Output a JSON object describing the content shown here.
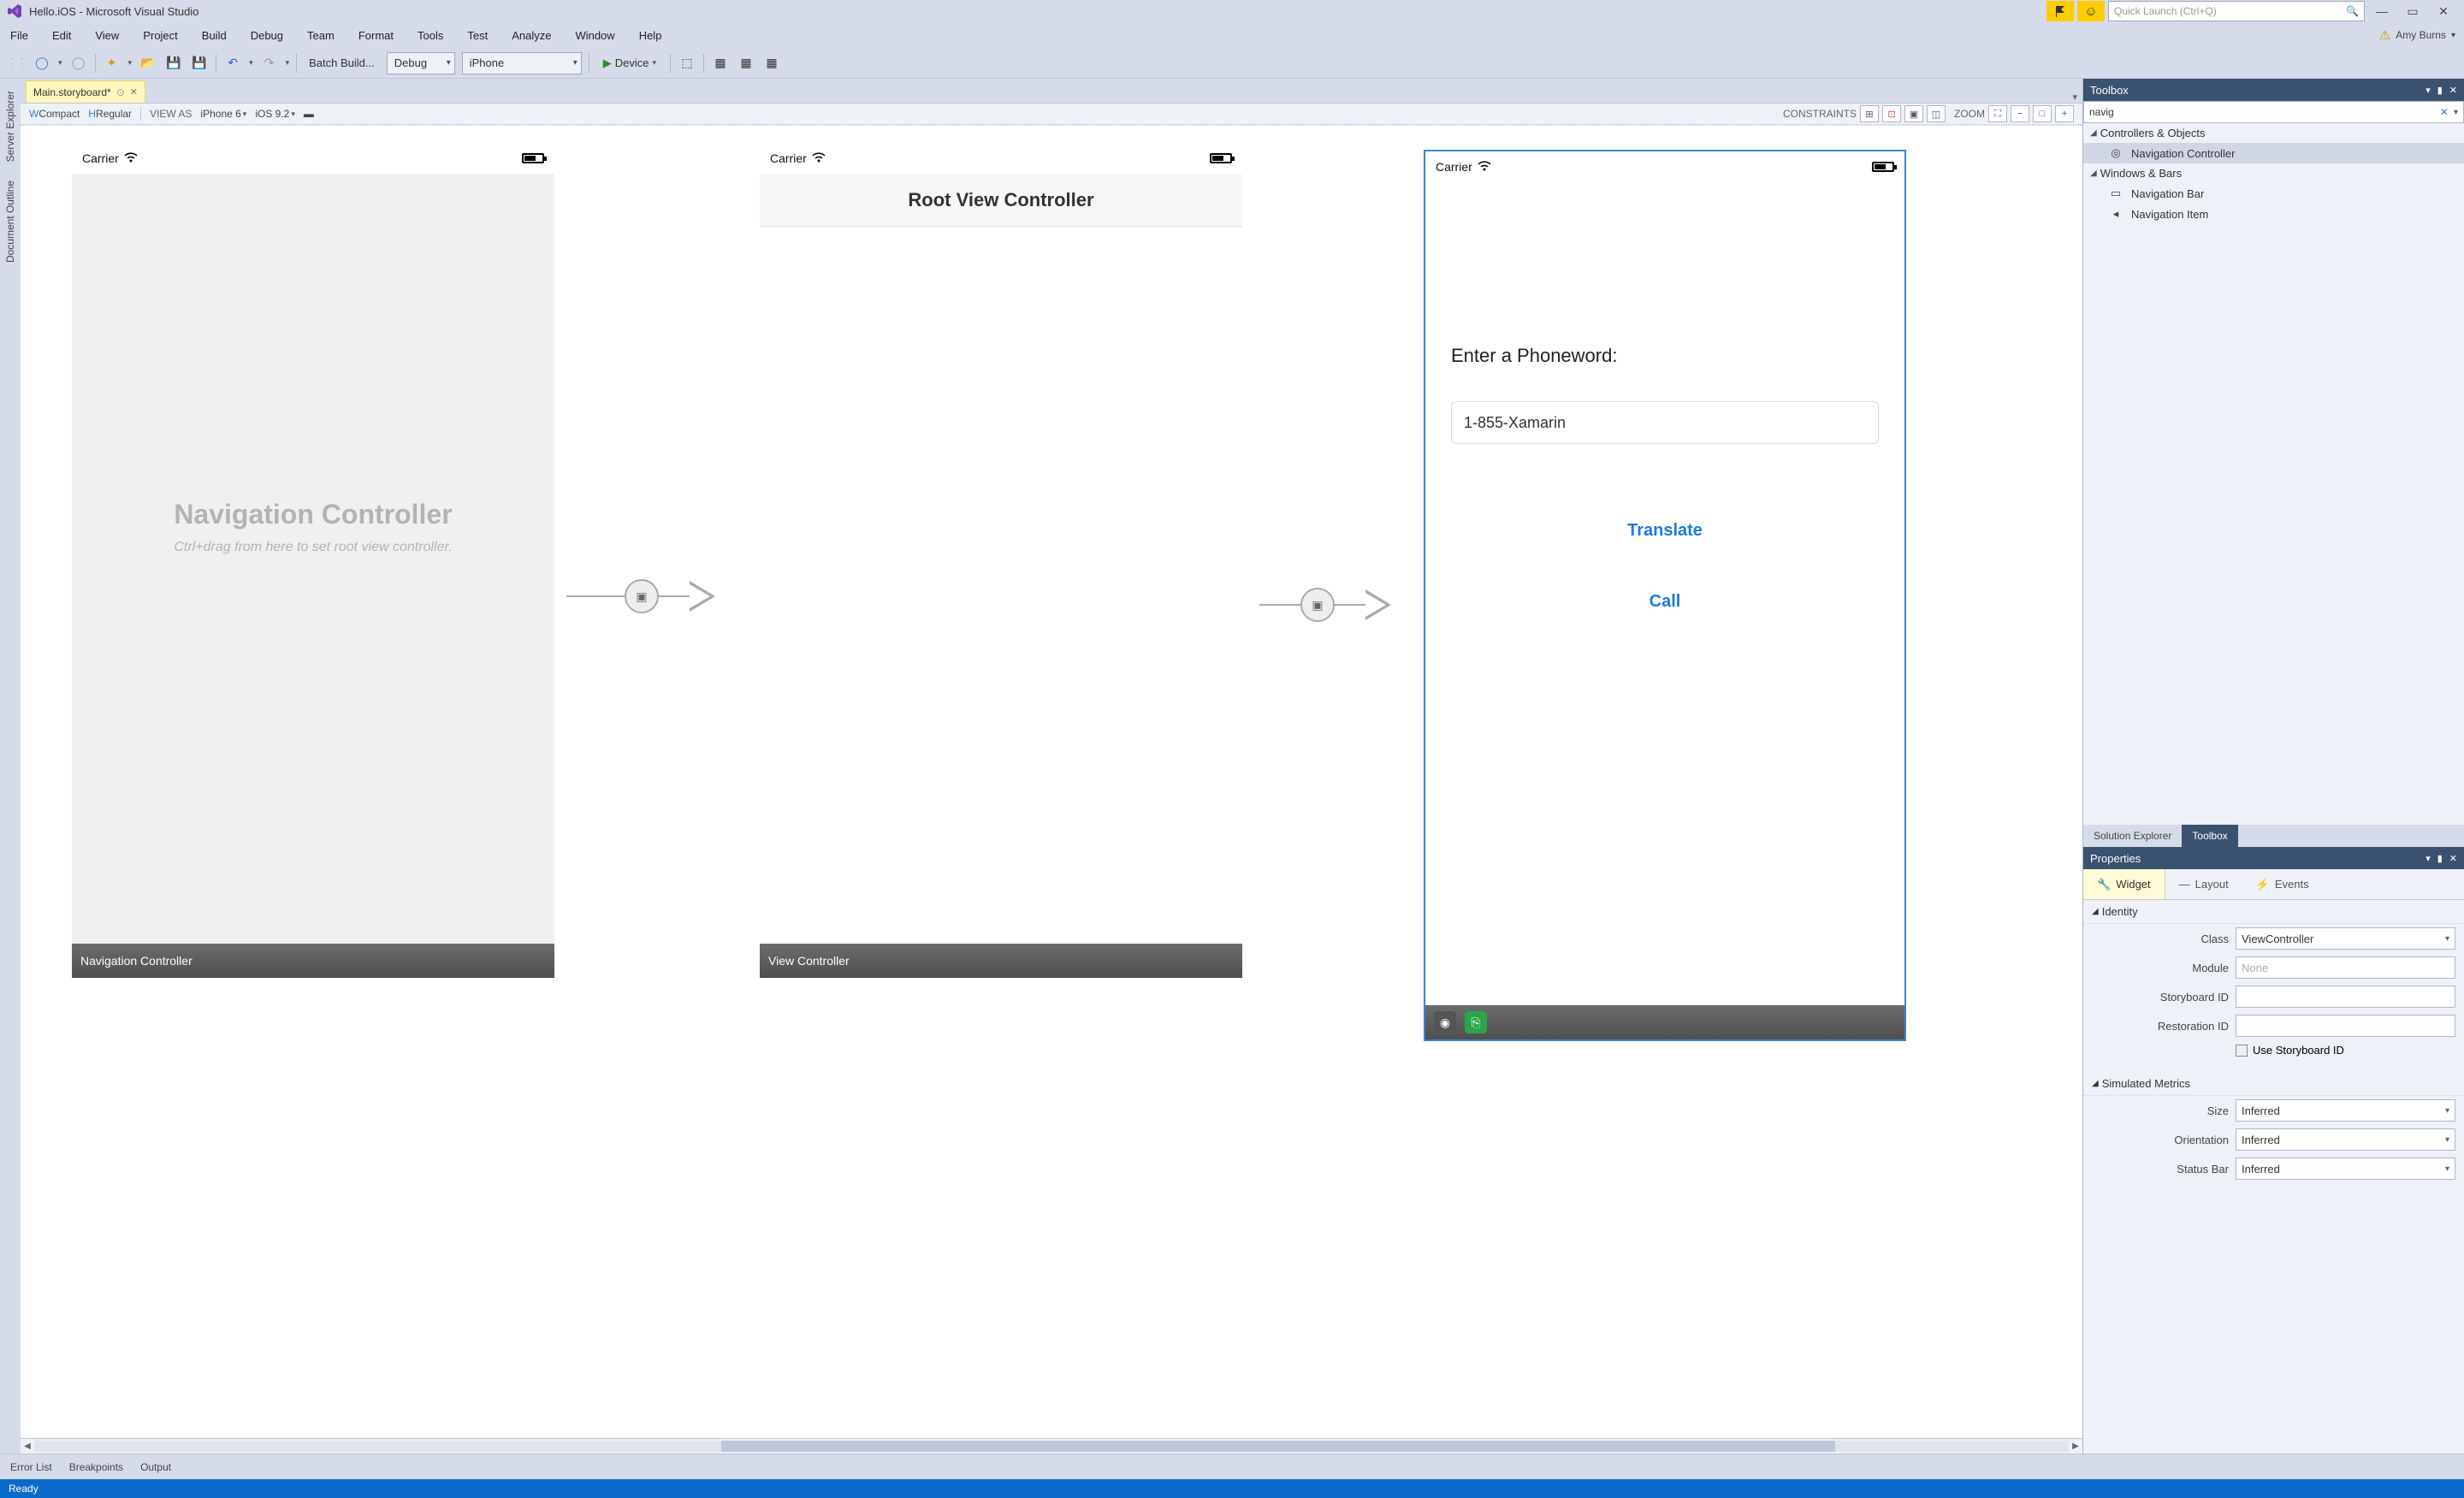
{
  "window": {
    "title": "Hello.iOS - Microsoft Visual Studio",
    "quick_launch_placeholder": "Quick Launch (Ctrl+Q)",
    "user_name": "Amy Burns"
  },
  "menu": [
    "File",
    "Edit",
    "View",
    "Project",
    "Build",
    "Debug",
    "Team",
    "Format",
    "Tools",
    "Test",
    "Analyze",
    "Window",
    "Help"
  ],
  "toolbar": {
    "batch_build": "Batch Build...",
    "config": "Debug",
    "platform": "iPhone",
    "device": "Device"
  },
  "doc_tab": {
    "name": "Main.storyboard*"
  },
  "designer_bar": {
    "size_w_compact": "WCompact",
    "size_h_regular": "HRegular",
    "view_as": "VIEW AS",
    "device": "iPhone 6",
    "os": "iOS 9.2",
    "constraints": "CONSTRAINTS",
    "zoom": "ZOOM"
  },
  "left_rail": [
    "Server Explorer",
    "Document Outline"
  ],
  "scenes": {
    "nav": {
      "carrier": "Carrier",
      "placeholder_title": "Navigation Controller",
      "placeholder_sub": "Ctrl+drag from here to set root view controller.",
      "footer": "Navigation Controller"
    },
    "root": {
      "carrier": "Carrier",
      "title": "Root View Controller",
      "footer": "View Controller"
    },
    "phone": {
      "carrier": "Carrier",
      "label": "Enter a Phoneword:",
      "input_value": "1-855-Xamarin",
      "translate": "Translate",
      "call": "Call"
    }
  },
  "toolbox": {
    "title": "Toolbox",
    "search_value": "navig",
    "cat1": "Controllers & Objects",
    "item1": "Navigation Controller",
    "cat2": "Windows & Bars",
    "item2": "Navigation Bar",
    "item3": "Navigation Item"
  },
  "panel_tabs": {
    "solution_explorer": "Solution Explorer",
    "toolbox": "Toolbox"
  },
  "properties": {
    "title": "Properties",
    "tabs": {
      "widget": "Widget",
      "layout": "Layout",
      "events": "Events"
    },
    "identity": "Identity",
    "class": "Class",
    "class_val": "ViewController",
    "module": "Module",
    "module_placeholder": "None",
    "storyboard_id": "Storyboard ID",
    "restoration_id": "Restoration ID",
    "use_storyboard_id": "Use Storyboard ID",
    "simulated_metrics": "Simulated Metrics",
    "size": "Size",
    "size_val": "Inferred",
    "orientation": "Orientation",
    "orientation_val": "Inferred",
    "status_bar": "Status Bar",
    "status_bar_val": "Inferred"
  },
  "bottom_tabs": [
    "Error List",
    "Breakpoints",
    "Output"
  ],
  "status": "Ready"
}
